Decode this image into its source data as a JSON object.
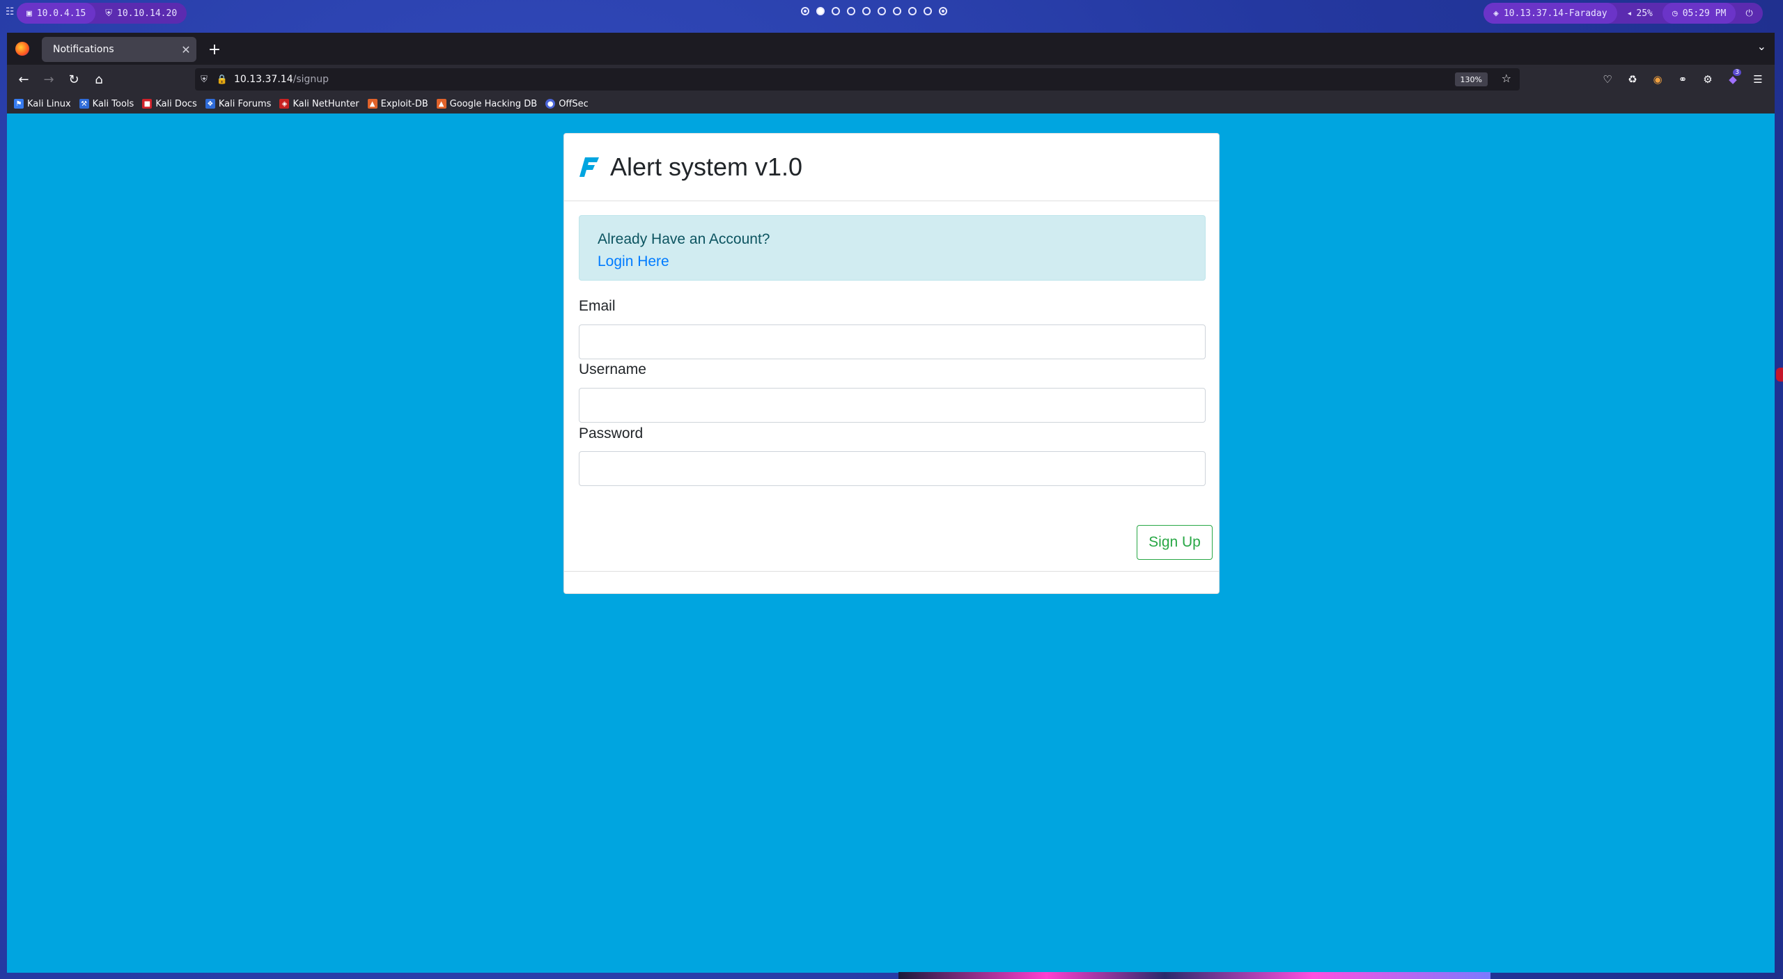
{
  "panel": {
    "left_pills": [
      "10.0.4.15",
      "10.10.14.20"
    ],
    "workspaces_count": 10,
    "active_workspace": 2,
    "right": {
      "target": "10.13.37.14-Faraday",
      "volume": "25%",
      "time": "05:29 PM"
    }
  },
  "browser": {
    "tab_title": "Notifications",
    "url_host": "10.13.37.14",
    "url_path": "/signup",
    "zoom": "130%",
    "extension_badge": "3",
    "bookmarks": [
      {
        "label": "Kali Linux",
        "icon": "kali-icon",
        "color": "#367bf0"
      },
      {
        "label": "Kali Tools",
        "icon": "kali-tools-icon",
        "color": "#2f6bd8"
      },
      {
        "label": "Kali Docs",
        "icon": "kali-docs-icon",
        "color": "#d0212a"
      },
      {
        "label": "Kali Forums",
        "icon": "kali-forums-icon",
        "color": "#2f6bd8"
      },
      {
        "label": "Kali NetHunter",
        "icon": "nethunter-icon",
        "color": "#c82121"
      },
      {
        "label": "Exploit-DB",
        "icon": "exploitdb-icon",
        "color": "#e0622a"
      },
      {
        "label": "Google Hacking DB",
        "icon": "ghdb-icon",
        "color": "#e0622a"
      },
      {
        "label": "OffSec",
        "icon": "offsec-icon",
        "color": "#4a64d8"
      }
    ]
  },
  "page": {
    "title": "Alert system v1.0",
    "alert_text": "Already Have an Account?",
    "alert_link": "Login Here",
    "fields": {
      "email_label": "Email",
      "username_label": "Username",
      "password_label": "Password"
    },
    "submit_label": "Sign Up",
    "colors": {
      "background": "#00a5e0",
      "alert_bg": "#d1ecf1",
      "link": "#007bff",
      "success": "#28a745"
    }
  }
}
